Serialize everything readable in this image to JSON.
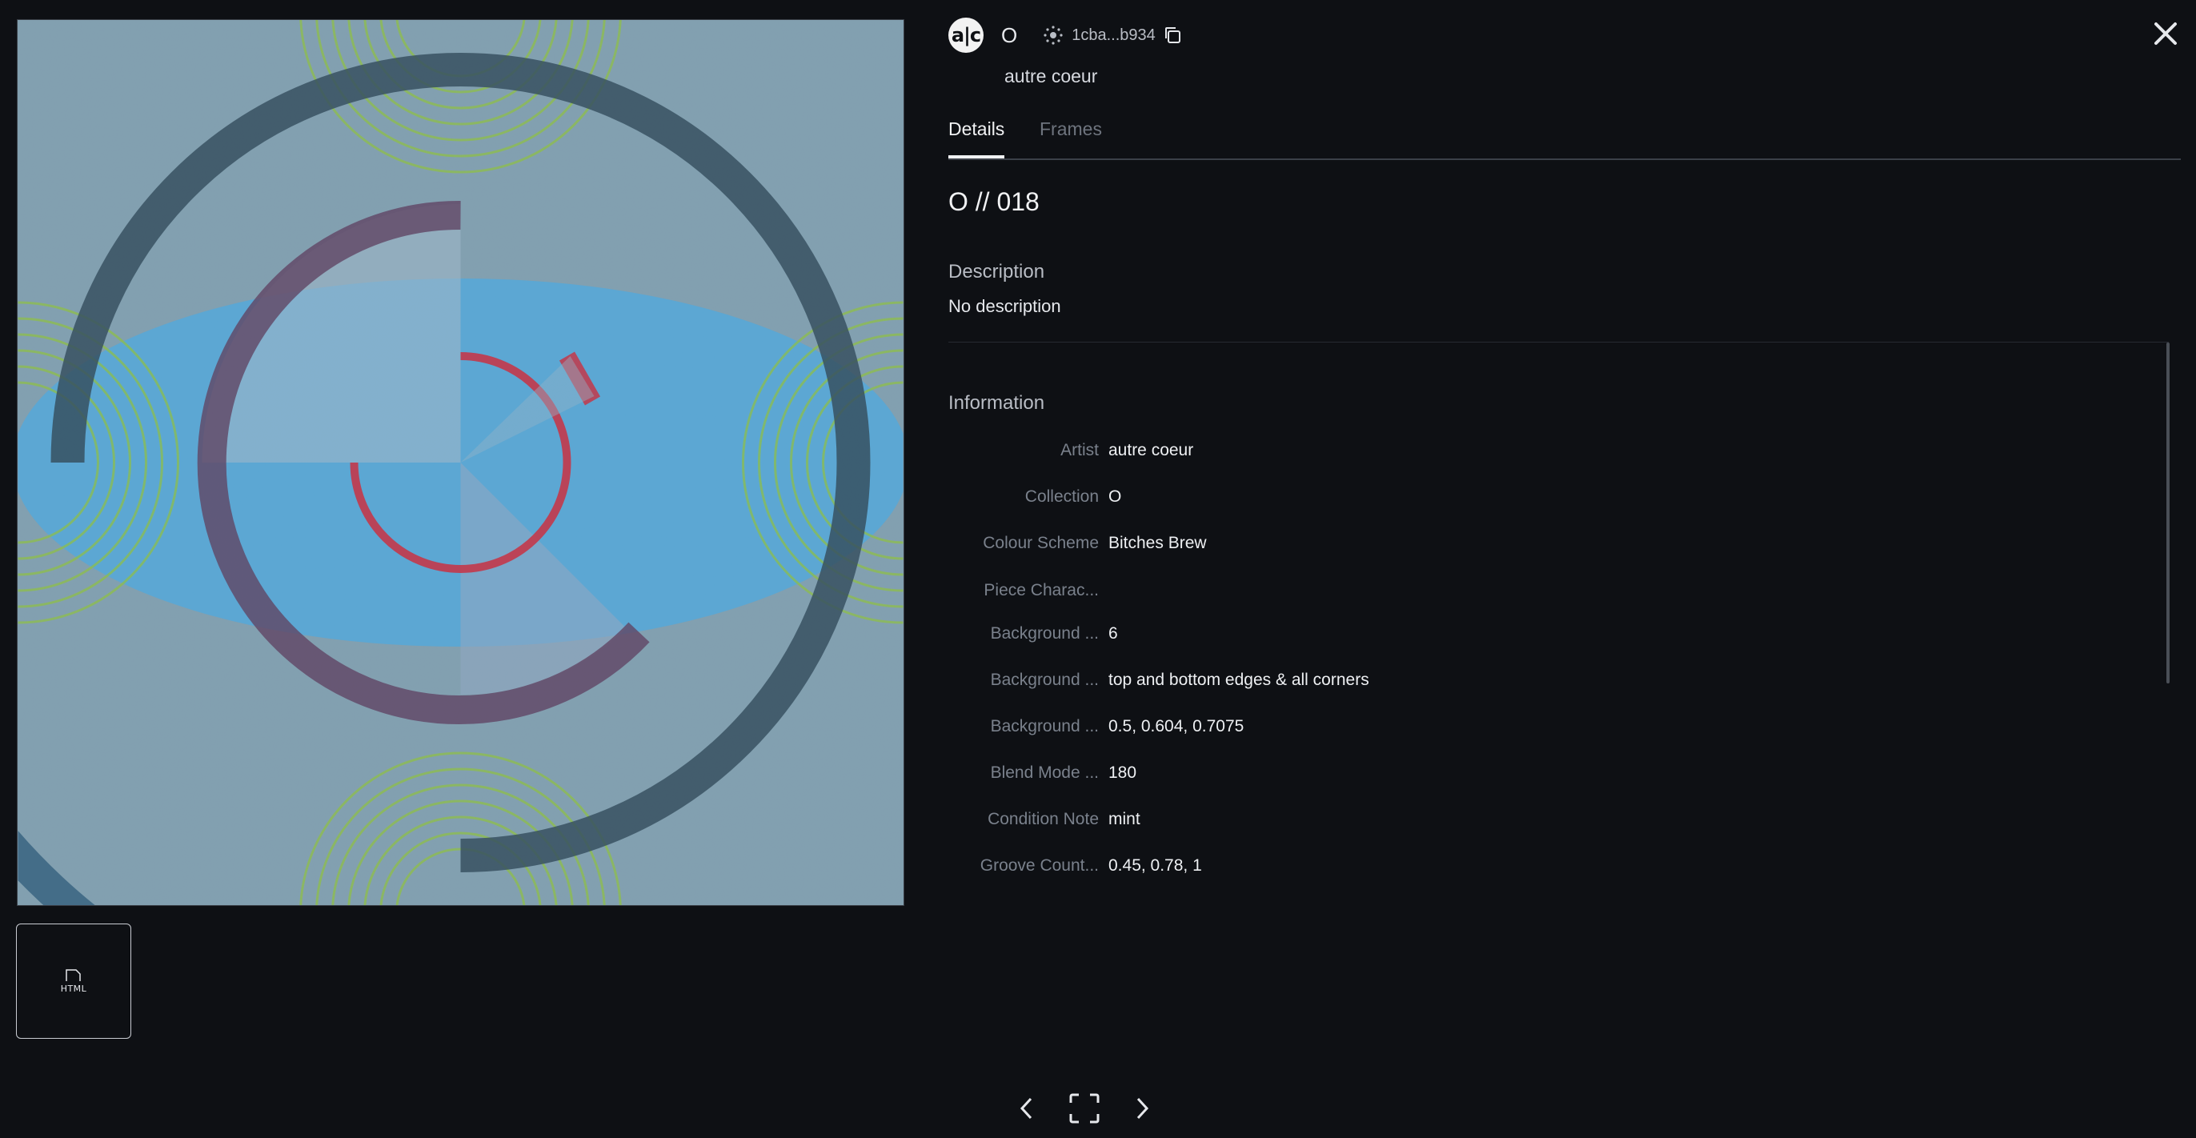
{
  "artwork": {
    "alt": "O // 018 artwork"
  },
  "thumbnail": {
    "label": "HTML",
    "icon": "html-file-icon"
  },
  "header": {
    "avatar_text": "a|c",
    "collection_symbol": "O",
    "contract_short": "1cba...b934",
    "artist_name": "autre coeur"
  },
  "tabs": {
    "details": "Details",
    "frames": "Frames"
  },
  "token": {
    "title": "O // 018"
  },
  "description": {
    "label": "Description",
    "text": "No description"
  },
  "information": {
    "label": "Information",
    "rows": [
      {
        "key": "Artist",
        "value": "autre coeur"
      },
      {
        "key": "Collection",
        "value": "O"
      },
      {
        "key": "Colour Scheme",
        "value": "Bitches Brew"
      },
      {
        "key": "Piece Charac...",
        "value": ""
      },
      {
        "key": "Background ...",
        "value": "6"
      },
      {
        "key": "Background ...",
        "value": "top and bottom edges & all corners"
      },
      {
        "key": "Background ...",
        "value": "0.5, 0.604, 0.7075"
      },
      {
        "key": "Blend Mode ...",
        "value": "180"
      },
      {
        "key": "Condition Note",
        "value": "mint"
      },
      {
        "key": "Groove Count...",
        "value": "0.45, 0.78, 1"
      }
    ]
  },
  "colors": {
    "background": "#0e1014",
    "text": "#e6e8ec",
    "muted": "#7a818c",
    "art_base": "#7d9cad",
    "art_blue": "#4ea6d8",
    "art_green": "#7fb33a",
    "art_ring_dark": "#2f4a5a",
    "art_ring_red": "#c23042"
  }
}
